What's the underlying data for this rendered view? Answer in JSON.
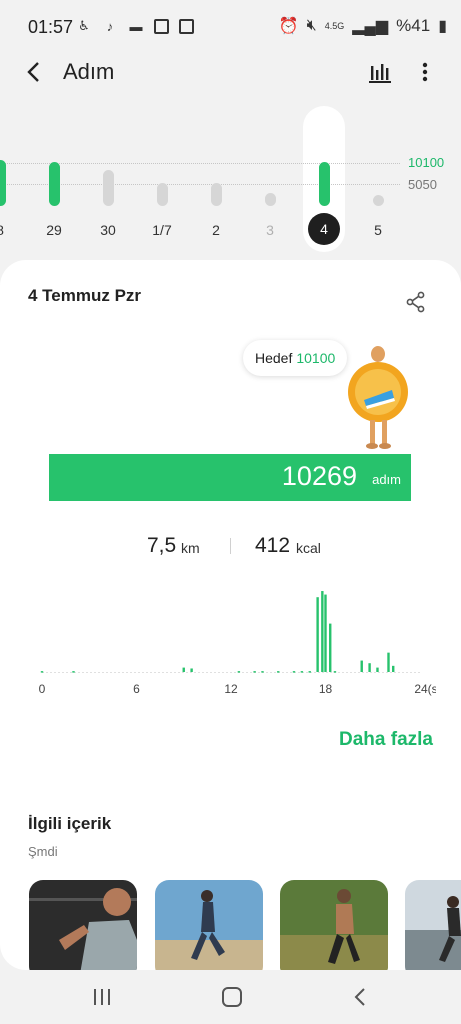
{
  "status_bar": {
    "time": "01:57",
    "battery": "%41",
    "signal_label": "4.5G"
  },
  "app_bar": {
    "title": "Adım",
    "back_icon": "back-arrow-icon",
    "chart_icon": "bar-chart-icon",
    "more_icon": "more-vert-icon"
  },
  "week": {
    "goal_label": "10100",
    "half_label": "5050",
    "days": [
      {
        "label": "8",
        "steps": 10900,
        "reached": true
      },
      {
        "label": "29",
        "steps": 10300,
        "reached": true
      },
      {
        "label": "30",
        "steps": 8400,
        "reached": false
      },
      {
        "label": "1/7",
        "steps": 5400,
        "reached": false
      },
      {
        "label": "2",
        "steps": 5400,
        "reached": false
      },
      {
        "label": "3",
        "steps": 3000,
        "reached": false
      },
      {
        "label": "4",
        "steps": 10269,
        "reached": true,
        "selected": true
      },
      {
        "label": "5",
        "steps": 2500,
        "reached": false
      }
    ]
  },
  "card": {
    "date_title": "4 Temmuz Pzr",
    "goal_prefix": "Hedef",
    "goal_value": "10100",
    "steps_value": "10269",
    "steps_unit": "adım",
    "distance_value": "7,5",
    "distance_unit": "km",
    "calorie_value": "412",
    "calorie_unit": "kcal",
    "more_link": "Daha fazla"
  },
  "chart_data": {
    "type": "bar",
    "x_ticks": [
      "0",
      "6",
      "12",
      "18",
      "24(s)"
    ],
    "x": [
      0,
      2,
      9,
      9.5,
      12.5,
      13.5,
      14,
      15,
      16,
      16.5,
      17,
      17.5,
      17.8,
      18,
      18.3,
      18.6,
      20.3,
      20.8,
      21.3,
      22,
      22.3
    ],
    "values": [
      1,
      1,
      5,
      4,
      1,
      1,
      1,
      1,
      1,
      1,
      1,
      85,
      92,
      88,
      55,
      1,
      13,
      10,
      5,
      22,
      7
    ],
    "ylim": [
      0,
      100
    ],
    "color": "#27c26c"
  },
  "related": {
    "title": "İlgili içerik",
    "subtitle": "Şmdi"
  },
  "colors": {
    "accent": "#27c26c",
    "accent_text": "#1db86a",
    "inactive_bar": "#d6d6d6"
  }
}
